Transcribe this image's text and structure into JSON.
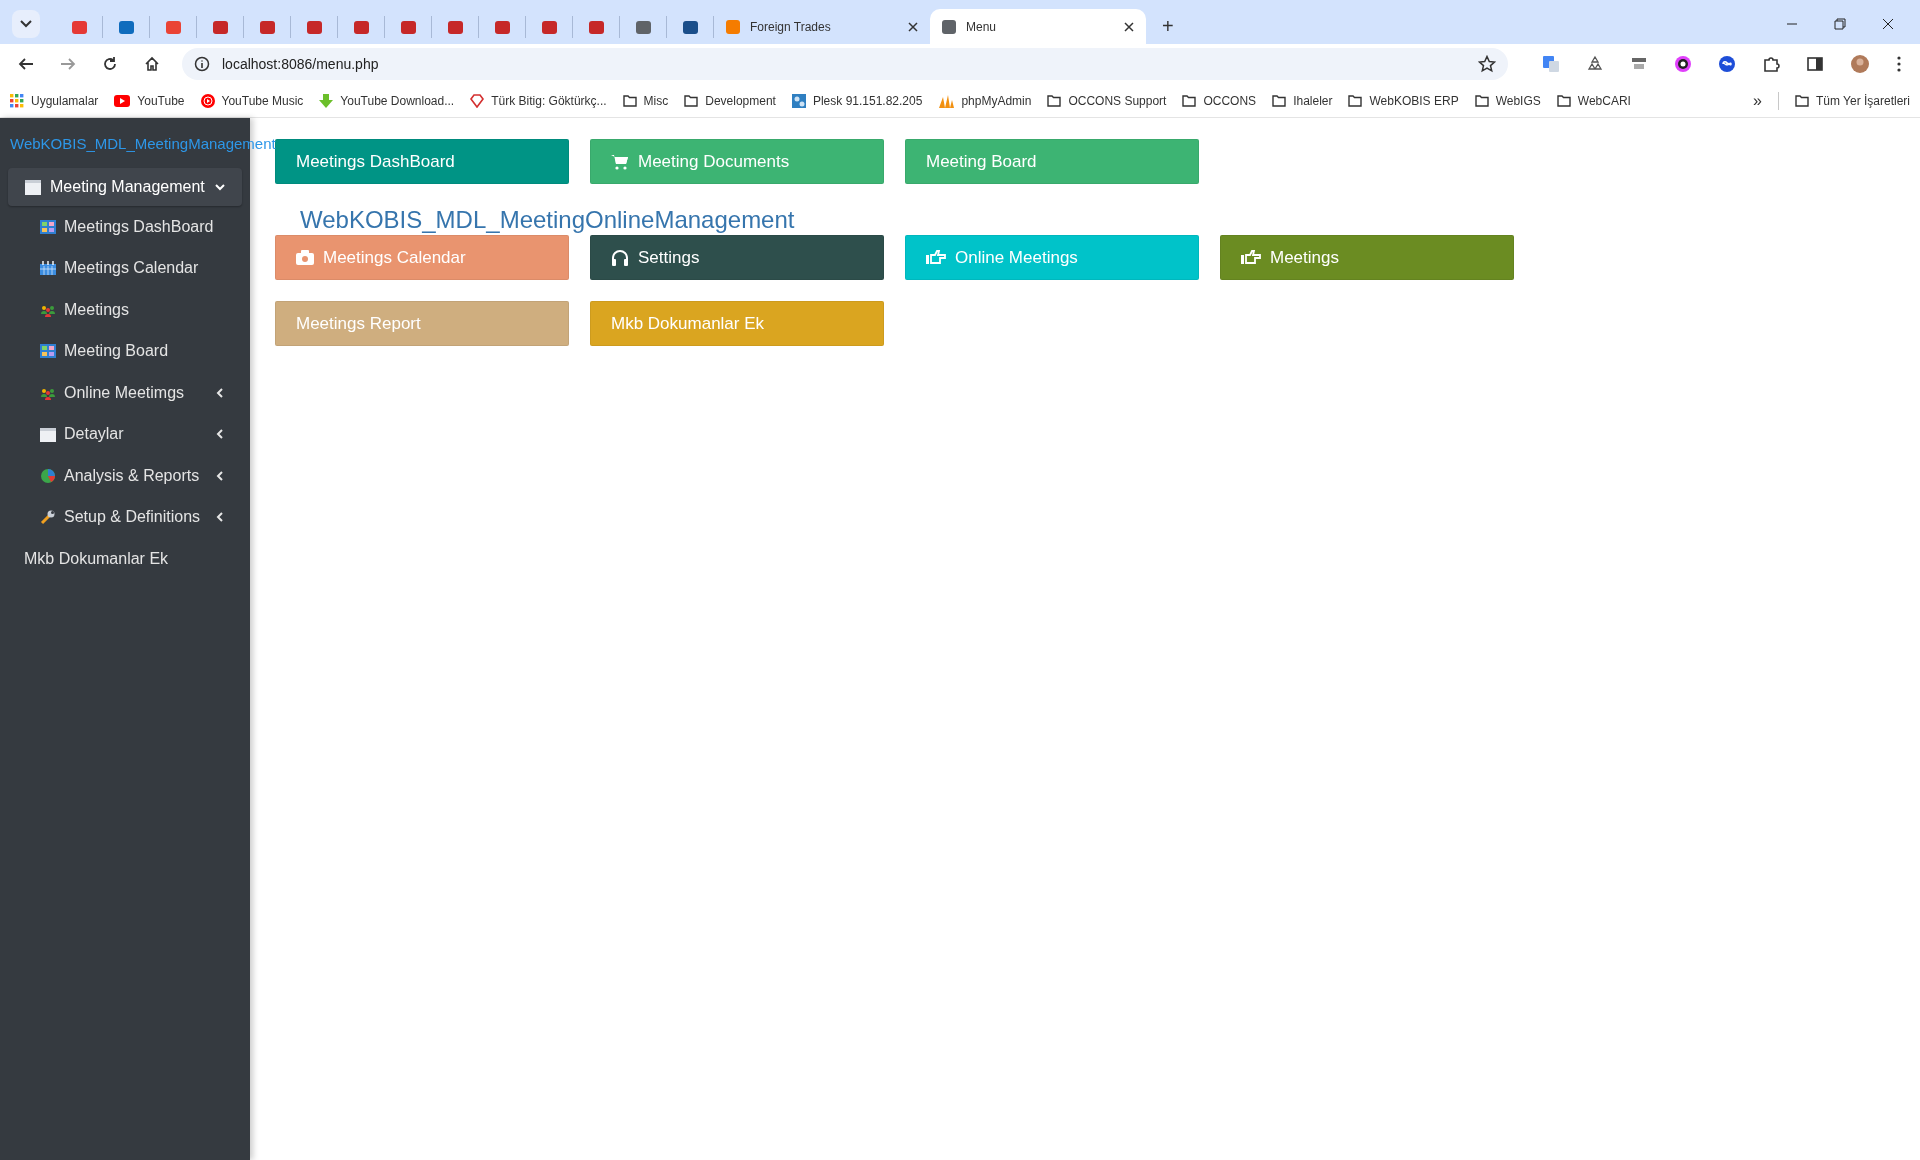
{
  "browser": {
    "tabs": [
      {
        "kind": "pinned",
        "color": "#e53935",
        "selected": false
      },
      {
        "kind": "pinned",
        "color": "#0f6cbd",
        "selected": false
      },
      {
        "kind": "pinned",
        "color": "#ea4335",
        "selected": false
      },
      {
        "kind": "pinned",
        "color": "#c62828",
        "selected": false
      },
      {
        "kind": "pinned",
        "color": "#c62828",
        "selected": false
      },
      {
        "kind": "pinned",
        "color": "#c62828",
        "selected": false
      },
      {
        "kind": "pinned",
        "color": "#c62828",
        "selected": false
      },
      {
        "kind": "pinned",
        "color": "#c62828",
        "selected": false
      },
      {
        "kind": "pinned",
        "color": "#c62828",
        "selected": false
      },
      {
        "kind": "pinned",
        "color": "#c62828",
        "selected": false
      },
      {
        "kind": "pinned",
        "color": "#c62828",
        "selected": false
      },
      {
        "kind": "pinned",
        "color": "#c62828",
        "selected": false
      },
      {
        "kind": "pinned",
        "color": "#5f6368",
        "selected": false
      },
      {
        "kind": "pinned",
        "color": "#1a4e8a",
        "selected": false
      },
      {
        "kind": "page",
        "title": "Foreign Trades",
        "color": "#f57c00",
        "selected": false
      },
      {
        "kind": "page",
        "title": "Menu",
        "color": "#5f6368",
        "selected": true
      }
    ],
    "new_tab": "+",
    "url": "localhost:8086/menu.php",
    "bookmarks": [
      {
        "kind": "apps",
        "label": "Uygulamalar"
      },
      {
        "kind": "youtube",
        "label": "YouTube"
      },
      {
        "kind": "music",
        "label": "YouTube Music"
      },
      {
        "kind": "download",
        "label": "YouTube Download..."
      },
      {
        "kind": "gem",
        "label": "Türk Bitig: Göktürkç..."
      },
      {
        "kind": "folder",
        "label": "Misc"
      },
      {
        "kind": "folder",
        "label": "Development"
      },
      {
        "kind": "plesk",
        "label": "Plesk 91.151.82.205"
      },
      {
        "kind": "pma",
        "label": "phpMyAdmin"
      },
      {
        "kind": "folder",
        "label": "OCCONS Support"
      },
      {
        "kind": "folder",
        "label": "OCCONS"
      },
      {
        "kind": "folder",
        "label": "Ihaleler"
      },
      {
        "kind": "folder",
        "label": "WebKOBIS ERP"
      },
      {
        "kind": "folder",
        "label": "WebIGS"
      },
      {
        "kind": "folder",
        "label": "WebCARI"
      }
    ],
    "more": "»",
    "all_bookmarks": "Tüm Yer İşaretleri"
  },
  "sidebar": {
    "title": "WebKOBIS_MDL_MeetingManagement",
    "menu": [
      {
        "label": "Meeting Management",
        "expanded": true,
        "children": [
          {
            "label": "Meetings DashBoard"
          },
          {
            "label": "Meetings Calendar"
          },
          {
            "label": "Meetings"
          },
          {
            "label": "Meeting Board"
          },
          {
            "label": "Online Meetimgs",
            "expanded": false
          },
          {
            "label": "Detaylar",
            "expanded": false
          },
          {
            "label": "Analysis & Reports",
            "expanded": false
          },
          {
            "label": "Setup & Definitions",
            "expanded": false
          }
        ]
      },
      {
        "label": "Mkb Dokumanlar Ek"
      }
    ]
  },
  "sections": [
    {
      "buttons": [
        {
          "label": "Meetings DashBoard",
          "color": "#009485"
        },
        {
          "label": "Meeting Documents",
          "color": "#3db473"
        },
        {
          "label": "Meeting Board",
          "color": "#3db473"
        }
      ]
    },
    {
      "title": "WebKOBIS_MDL_MeetingOnlineManagement",
      "buttons": [
        {
          "label": "Meetings Calendar",
          "color": "#e9946f"
        },
        {
          "label": "Settings",
          "color": "#2e4f4c"
        },
        {
          "label": "Online Meetings",
          "color": "#00c3c9"
        },
        {
          "label": "Meetings",
          "color": "#6b8c22"
        },
        {
          "label": "Meetings Report",
          "color": "#cfae7f"
        },
        {
          "label": "Mkb Dokumanlar Ek",
          "color": "#daa520"
        }
      ]
    }
  ]
}
